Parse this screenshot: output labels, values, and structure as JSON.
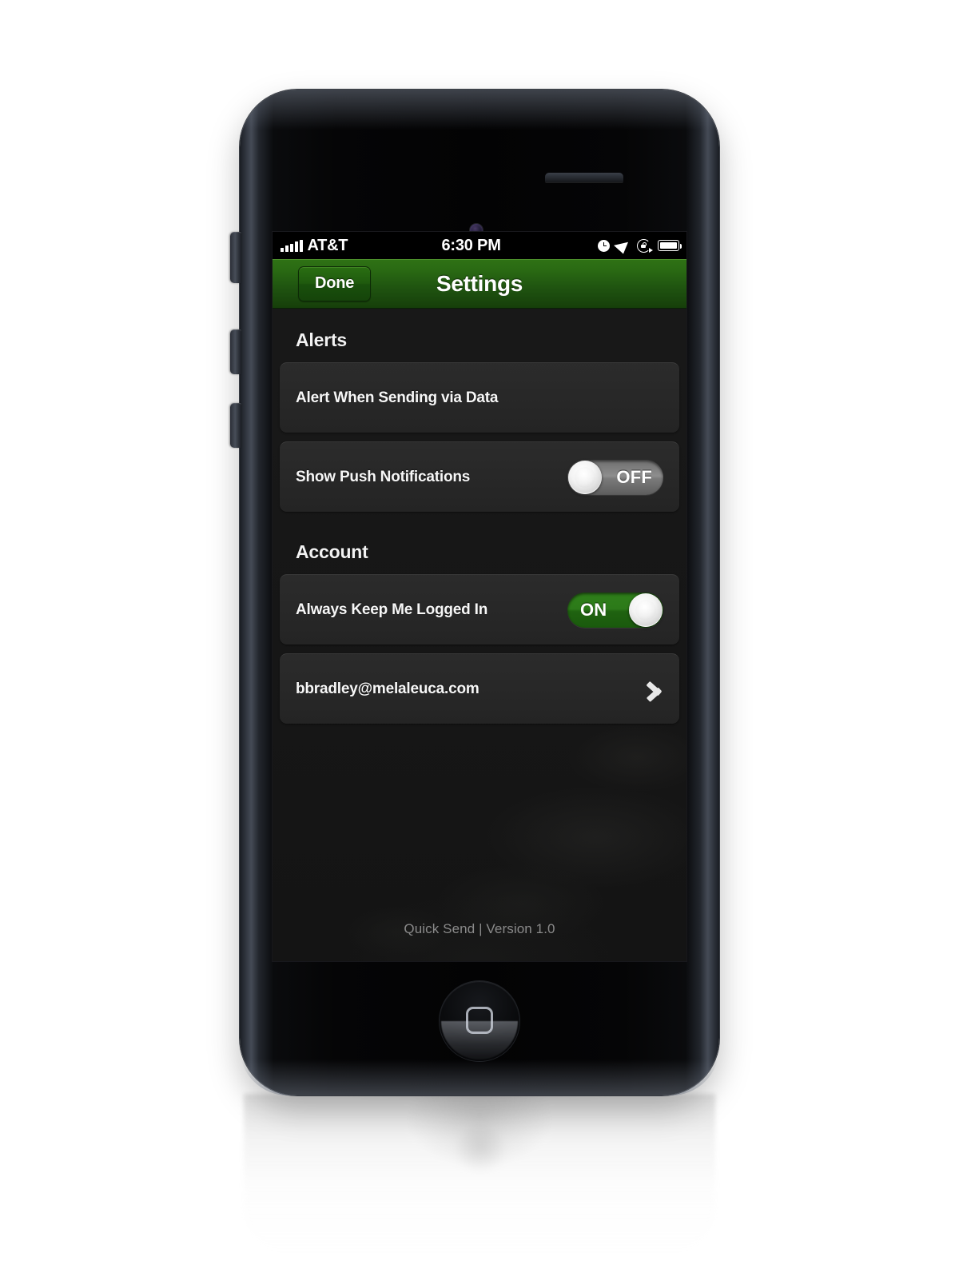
{
  "device": {
    "hardware": {
      "power_button": "power-button",
      "mute_switch": "mute-switch",
      "volume_up": "volume-up-button",
      "volume_down": "volume-down-button",
      "home_button": "home-button",
      "front_camera": "front-camera",
      "earpiece": "earpiece-speaker"
    }
  },
  "status_bar": {
    "carrier": "AT&T",
    "signal_bars_filled": 5,
    "signal_bars_total": 5,
    "time": "6:30 PM",
    "icons": [
      "alarm-clock-icon",
      "location-arrow-icon",
      "rotation-lock-icon",
      "battery-icon"
    ],
    "battery_level_percent": 100
  },
  "nav_bar": {
    "title": "Settings",
    "done_label": "Done",
    "accent_color": "#2a6a13"
  },
  "sections": [
    {
      "header": "Alerts",
      "rows": [
        {
          "label": "Alert When Sending via Data",
          "control": "none"
        },
        {
          "label": "Show Push Notifications",
          "control": "toggle",
          "toggle_state": "OFF"
        }
      ]
    },
    {
      "header": "Account",
      "rows": [
        {
          "label": "Always Keep Me Logged In",
          "control": "toggle",
          "toggle_state": "ON"
        },
        {
          "label": "bbradley@melaleuca.com",
          "control": "chevron"
        }
      ]
    }
  ],
  "footer": {
    "version_text": "Quick Send | Version 1.0"
  },
  "colors": {
    "nav_green_top": "#2f7215",
    "nav_green_bottom": "#163f0a",
    "toggle_on_green": "#2c7a19",
    "toggle_off_gray": "#8e8e8e",
    "row_background": "#2e2e2e",
    "screen_background": "#1b1b1b"
  }
}
